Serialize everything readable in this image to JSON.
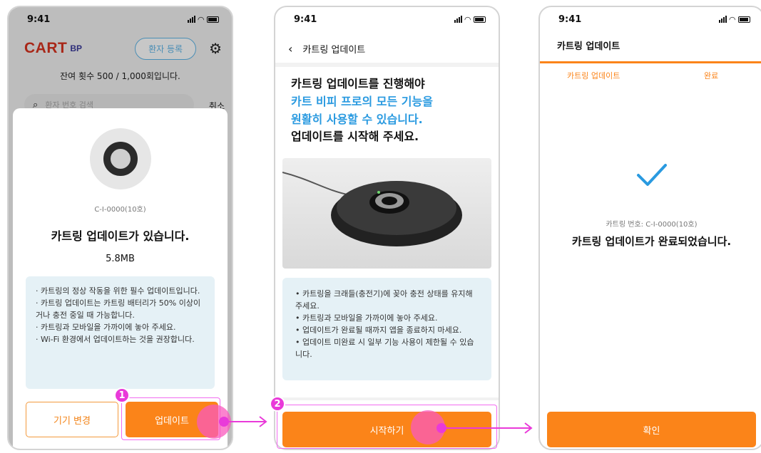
{
  "status": {
    "time": "9:41"
  },
  "phone1": {
    "logo": "CART",
    "logo_sub": "BP",
    "register_button": "환자 등록",
    "remaining": "잔여 횟수 500 / 1,000회입니다.",
    "search_placeholder": "환자 번호 검색",
    "cancel": "취소",
    "sheet": {
      "device_code": "C-I-0000(10호)",
      "title": "카트링 업데이트가 있습니다.",
      "size": "5.8MB",
      "notes": [
        "· 카트링의 정상 작동을 위한 필수 업데이트입니다.",
        "· 카트링 업데이트는 카트링 배터리가 50% 이상이거나 충전 중일 때 가능합니다.",
        "· 카트링과 모바일을 가까이에 놓아 주세요.",
        "· Wi-Fi 환경에서 업데이트하는 것을 권장합니다."
      ],
      "change_device_button": "기기 변경",
      "update_button": "업데이트"
    }
  },
  "phone2": {
    "nav_title": "카트링 업데이트",
    "headline_line1": "카트링 업데이트를 진행해야",
    "headline_line2": "카트 비피 프로의 모든 기능을",
    "headline_line3": "원활히 사용할 수 있습니다.",
    "headline_line4": "업데이트를 시작해 주세요.",
    "notes": [
      "• 카트링을 크래들(충전기)에 꽂아 충전 상태를 유지해 주세요.",
      "• 카트링과 모바일을 가까이에 놓아 주세요.",
      "• 업데이트가 완료될 때까지 앱을 종료하지 마세요.",
      "• 업데이트 미완료 시 일부 기능 사용이 제한될 수 있습니다."
    ],
    "start_button": "시작하기"
  },
  "phone3": {
    "title": "카트링 업데이트",
    "step1": "카트링 업데이트",
    "step2": "완료",
    "device_code": "카트링 번호: C-I-0000(10호)",
    "done_title": "카트링 업데이트가 완료되었습니다.",
    "confirm_button": "확인"
  },
  "steps": [
    "1",
    "2"
  ],
  "colors": {
    "accent": "#fb8419",
    "blue": "#2a9ae0",
    "highlight": "#e93ad9"
  }
}
